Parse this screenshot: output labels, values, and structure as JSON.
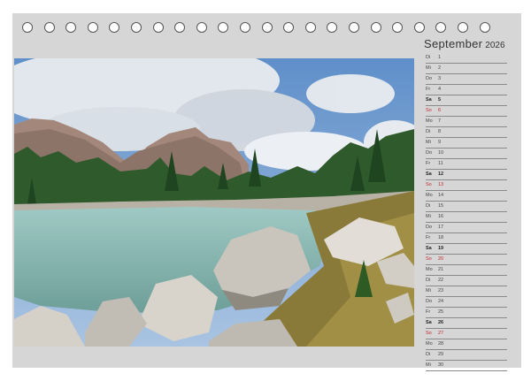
{
  "calendar": {
    "month": "September",
    "year": "2026",
    "accent_sunday": "#c0262b",
    "days": [
      {
        "name": "Di",
        "num": "1",
        "type": "weekday"
      },
      {
        "name": "Mi",
        "num": "2",
        "type": "weekday"
      },
      {
        "name": "Do",
        "num": "3",
        "type": "weekday"
      },
      {
        "name": "Fr",
        "num": "4",
        "type": "weekday"
      },
      {
        "name": "Sa",
        "num": "5",
        "type": "sat"
      },
      {
        "name": "So",
        "num": "6",
        "type": "sun"
      },
      {
        "name": "Mo",
        "num": "7",
        "type": "weekday"
      },
      {
        "name": "Di",
        "num": "8",
        "type": "weekday"
      },
      {
        "name": "Mi",
        "num": "9",
        "type": "weekday"
      },
      {
        "name": "Do",
        "num": "10",
        "type": "weekday"
      },
      {
        "name": "Fr",
        "num": "11",
        "type": "weekday"
      },
      {
        "name": "Sa",
        "num": "12",
        "type": "sat"
      },
      {
        "name": "So",
        "num": "13",
        "type": "sun"
      },
      {
        "name": "Mo",
        "num": "14",
        "type": "weekday"
      },
      {
        "name": "Di",
        "num": "15",
        "type": "weekday"
      },
      {
        "name": "Mi",
        "num": "16",
        "type": "weekday"
      },
      {
        "name": "Do",
        "num": "17",
        "type": "weekday"
      },
      {
        "name": "Fr",
        "num": "18",
        "type": "weekday"
      },
      {
        "name": "Sa",
        "num": "19",
        "type": "sat"
      },
      {
        "name": "So",
        "num": "20",
        "type": "sun"
      },
      {
        "name": "Mo",
        "num": "21",
        "type": "weekday"
      },
      {
        "name": "Di",
        "num": "22",
        "type": "weekday"
      },
      {
        "name": "Mi",
        "num": "23",
        "type": "weekday"
      },
      {
        "name": "Do",
        "num": "24",
        "type": "weekday"
      },
      {
        "name": "Fr",
        "num": "25",
        "type": "weekday"
      },
      {
        "name": "Sa",
        "num": "26",
        "type": "sat"
      },
      {
        "name": "So",
        "num": "27",
        "type": "sun"
      },
      {
        "name": "Mo",
        "num": "28",
        "type": "weekday"
      },
      {
        "name": "Di",
        "num": "29",
        "type": "weekday"
      },
      {
        "name": "Mi",
        "num": "30",
        "type": "weekday"
      }
    ]
  },
  "binding": {
    "ring_count": 22
  },
  "photo": {
    "subject": "alpine-lake-landscape"
  }
}
